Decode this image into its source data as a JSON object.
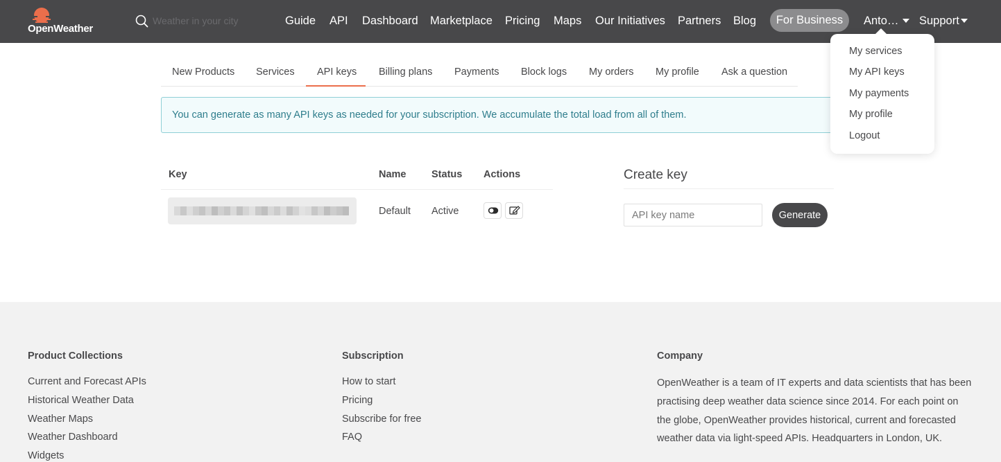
{
  "header": {
    "logo_text": "OpenWeather",
    "search_placeholder": "Weather in your city",
    "nav": {
      "guide": "Guide",
      "api": "API",
      "dashboard": "Dashboard",
      "marketplace": "Marketplace",
      "pricing": "Pricing",
      "maps": "Maps",
      "initiatives": "Our Initiatives",
      "partners": "Partners",
      "blog": "Blog",
      "business": "For Business",
      "user": "Anto…",
      "support": "Support"
    }
  },
  "user_menu": {
    "services": "My services",
    "api_keys": "My API keys",
    "payments": "My payments",
    "profile": "My profile",
    "logout": "Logout"
  },
  "tabs": {
    "new_products": "New Products",
    "services": "Services",
    "api_keys": "API keys",
    "billing": "Billing plans",
    "payments": "Payments",
    "block_logs": "Block logs",
    "orders": "My orders",
    "profile": "My profile",
    "ask": "Ask a question",
    "active": "API keys"
  },
  "alert": {
    "text": "You can generate as many API keys as needed for your subscription. We accumulate the total load from all of them."
  },
  "keys_table": {
    "headers": {
      "key": "Key",
      "name": "Name",
      "status": "Status",
      "actions": "Actions"
    },
    "rows": [
      {
        "key": "",
        "name": "Default",
        "status": "Active"
      }
    ]
  },
  "create_key": {
    "title": "Create key",
    "input_placeholder": "API key name",
    "button": "Generate"
  },
  "footer": {
    "products": {
      "heading": "Product Collections",
      "links": [
        "Current and Forecast APIs",
        "Historical Weather Data",
        "Weather Maps",
        "Weather Dashboard",
        "Widgets"
      ]
    },
    "subscription": {
      "heading": "Subscription",
      "links": [
        "How to start",
        "Pricing",
        "Subscribe for free",
        "FAQ"
      ]
    },
    "company": {
      "heading": "Company",
      "text": "OpenWeather is a team of IT experts and data scientists that has been practising deep weather data science since 2014. For each point on the globe, OpenWeather provides historical, current and forecasted weather data via light-speed APIs. Headquarters in London, UK."
    }
  },
  "colors": {
    "header_bg": "#48484a",
    "accent": "#eb6e4b",
    "alert_text": "#2e7d8c",
    "footer_bg": "#f2f2f2"
  }
}
